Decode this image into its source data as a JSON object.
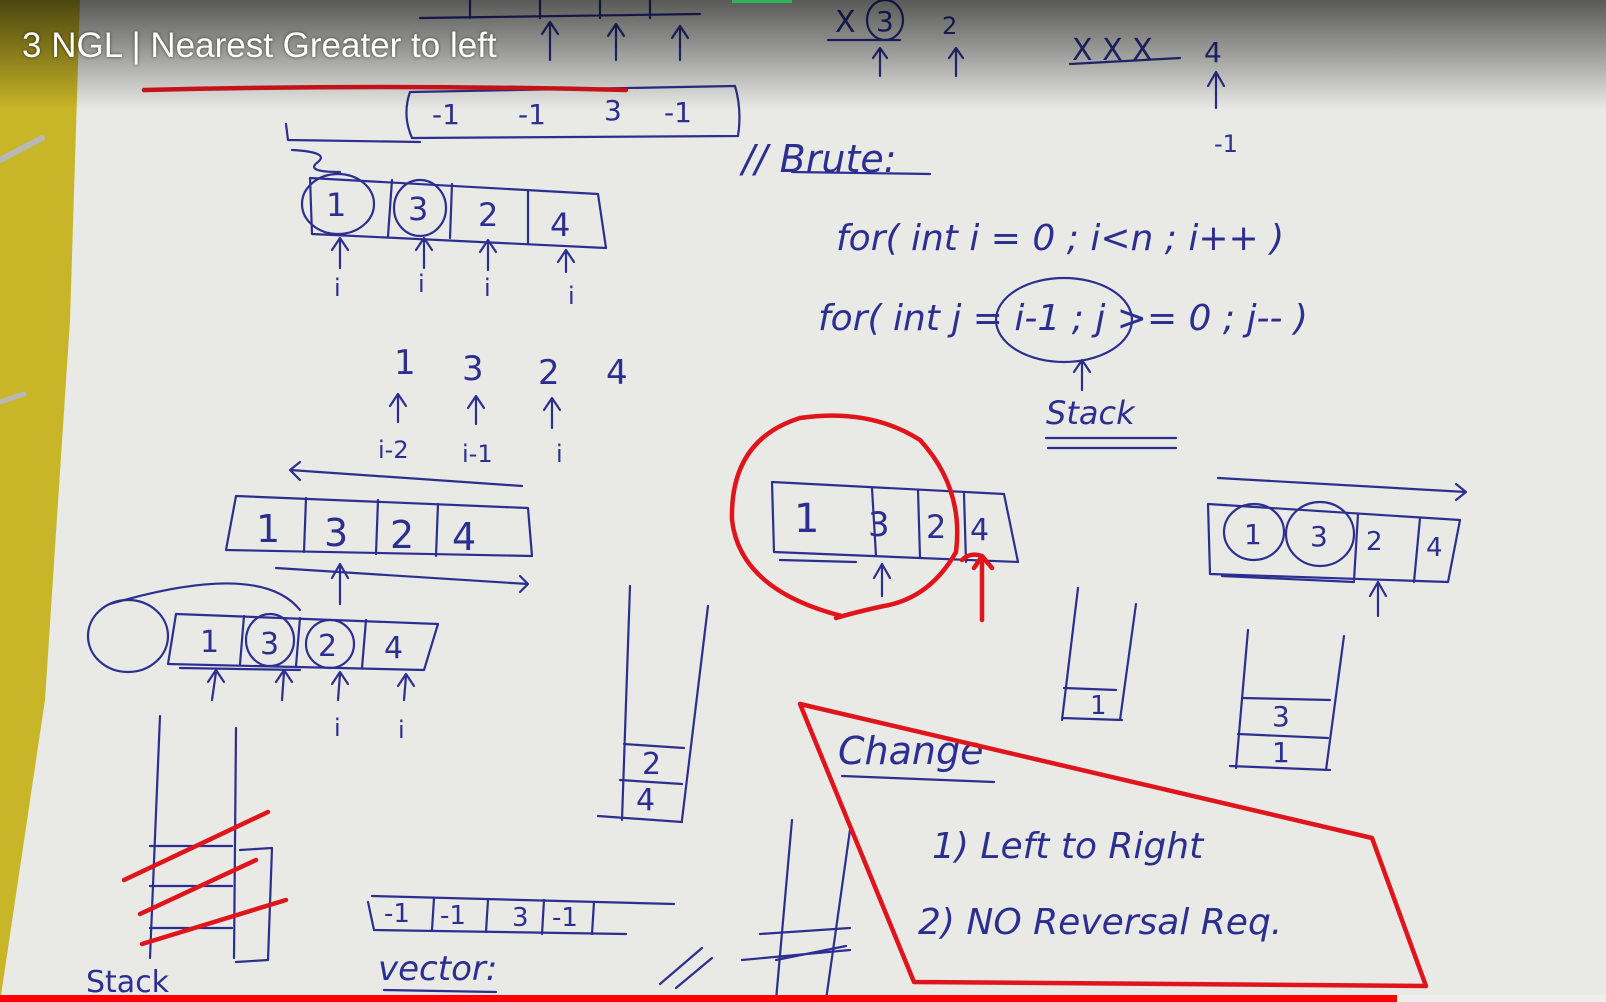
{
  "video": {
    "title": "3 NGL | Nearest Greater to left",
    "progress_fraction": 0.87
  },
  "colors": {
    "paper": "#e9e9e6",
    "ink": "#2c2f8f",
    "marker_red": "#e0151b",
    "tablet_yellow": "#c9b628",
    "progress_red": "#ff0000",
    "buffer_green": "#2fb35b"
  },
  "whiteboard": {
    "top_strip": {
      "strike": "X",
      "circled": "3",
      "two": "2",
      "four": "4",
      "struck_x": "X X X",
      "minus_one": "-1"
    },
    "top_array": {
      "cells": [
        "-1",
        "-1",
        "3",
        "-1"
      ]
    },
    "array_circled": {
      "cells": [
        "1",
        "3",
        "2",
        "4"
      ],
      "pointer": "i"
    },
    "brute": {
      "heading": "// Brute:",
      "line1": "for( int i = 0 ;  i<n ;  i++ )",
      "line2": "for( int  j = i-1 ;  j >= 0  ; j-- )",
      "stack_label": "Stack"
    },
    "mid_sequence": {
      "values": [
        "1",
        "3",
        "2",
        "4"
      ],
      "labels": [
        "i-2",
        "i-1",
        "i"
      ]
    },
    "array_mid_left": {
      "cells": [
        "1",
        "3",
        "2",
        "4"
      ]
    },
    "array_bottom_left": {
      "cells": [
        "1",
        "3",
        "2",
        "4"
      ],
      "pointer": "i"
    },
    "stack_left": {
      "items": [
        "2",
        "4"
      ]
    },
    "array_center": {
      "cells": [
        "1",
        "3",
        "2",
        "4"
      ]
    },
    "stack_small": {
      "items": [
        "1"
      ]
    },
    "array_right": {
      "cells": [
        "1",
        "3",
        "2",
        "4"
      ]
    },
    "stack_right": {
      "items": [
        "3",
        "1"
      ]
    },
    "change": {
      "heading": "Change",
      "item1": "1)  Left to Right",
      "item2": "2)  NO Reversal Req."
    },
    "result_array": {
      "cells": [
        "-1",
        "-1",
        "3",
        "-1"
      ]
    },
    "vector_label": "vector:"
  }
}
